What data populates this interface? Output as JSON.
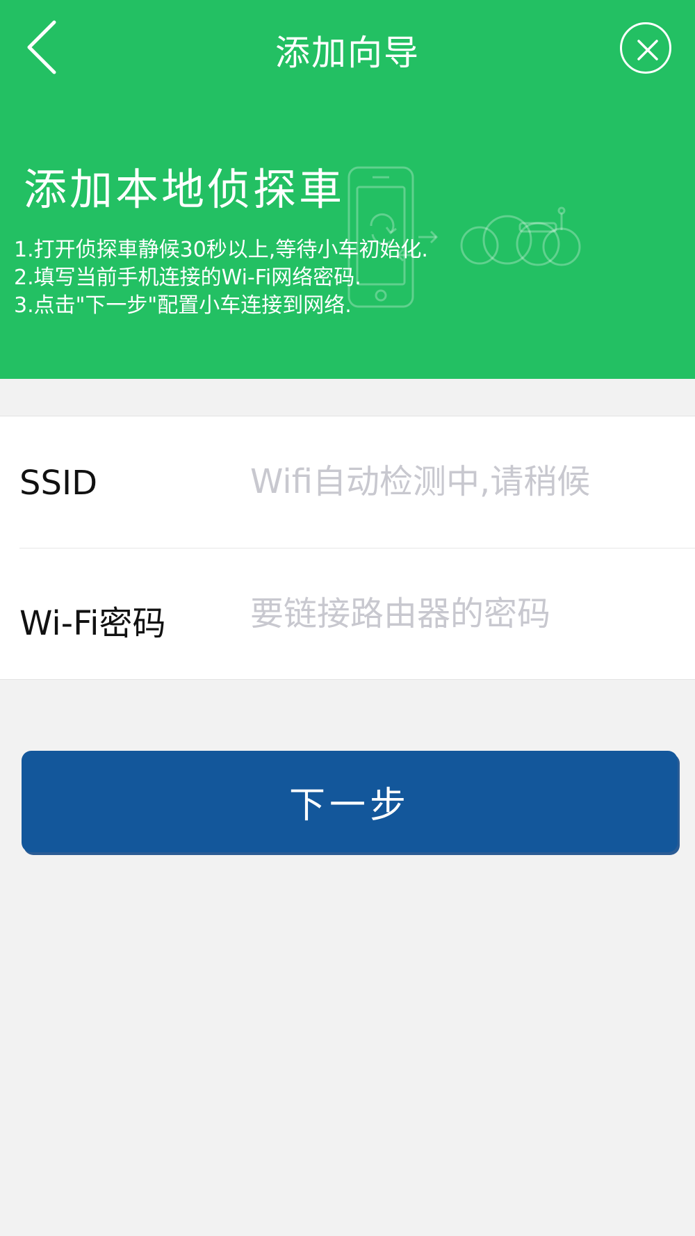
{
  "nav": {
    "title": "添加向导",
    "back_icon": "chevron-left-icon",
    "close_icon": "close-circle-icon"
  },
  "hero": {
    "title": "添加本地侦探車",
    "steps": [
      "1.打开侦探車静候30秒以上,等待小车初始化.",
      "2.填写当前手机连接的Wi-Fi网络密码.",
      "3.点击\"下一步\"配置小车连接到网络."
    ],
    "illustration_icon": "phone-to-car-icon"
  },
  "form": {
    "ssid": {
      "label": "SSID",
      "placeholder": "Wifi自动检测中,请稍候",
      "value": ""
    },
    "password": {
      "label": "Wi-Fi密码",
      "placeholder": "要链接路由器的密码",
      "value": ""
    }
  },
  "next_button": {
    "label": "下一步"
  },
  "colors": {
    "header_bg": "#23c063",
    "button_bg": "#13579b",
    "page_bg": "#f2f2f2",
    "placeholder": "#c8c8cf"
  }
}
